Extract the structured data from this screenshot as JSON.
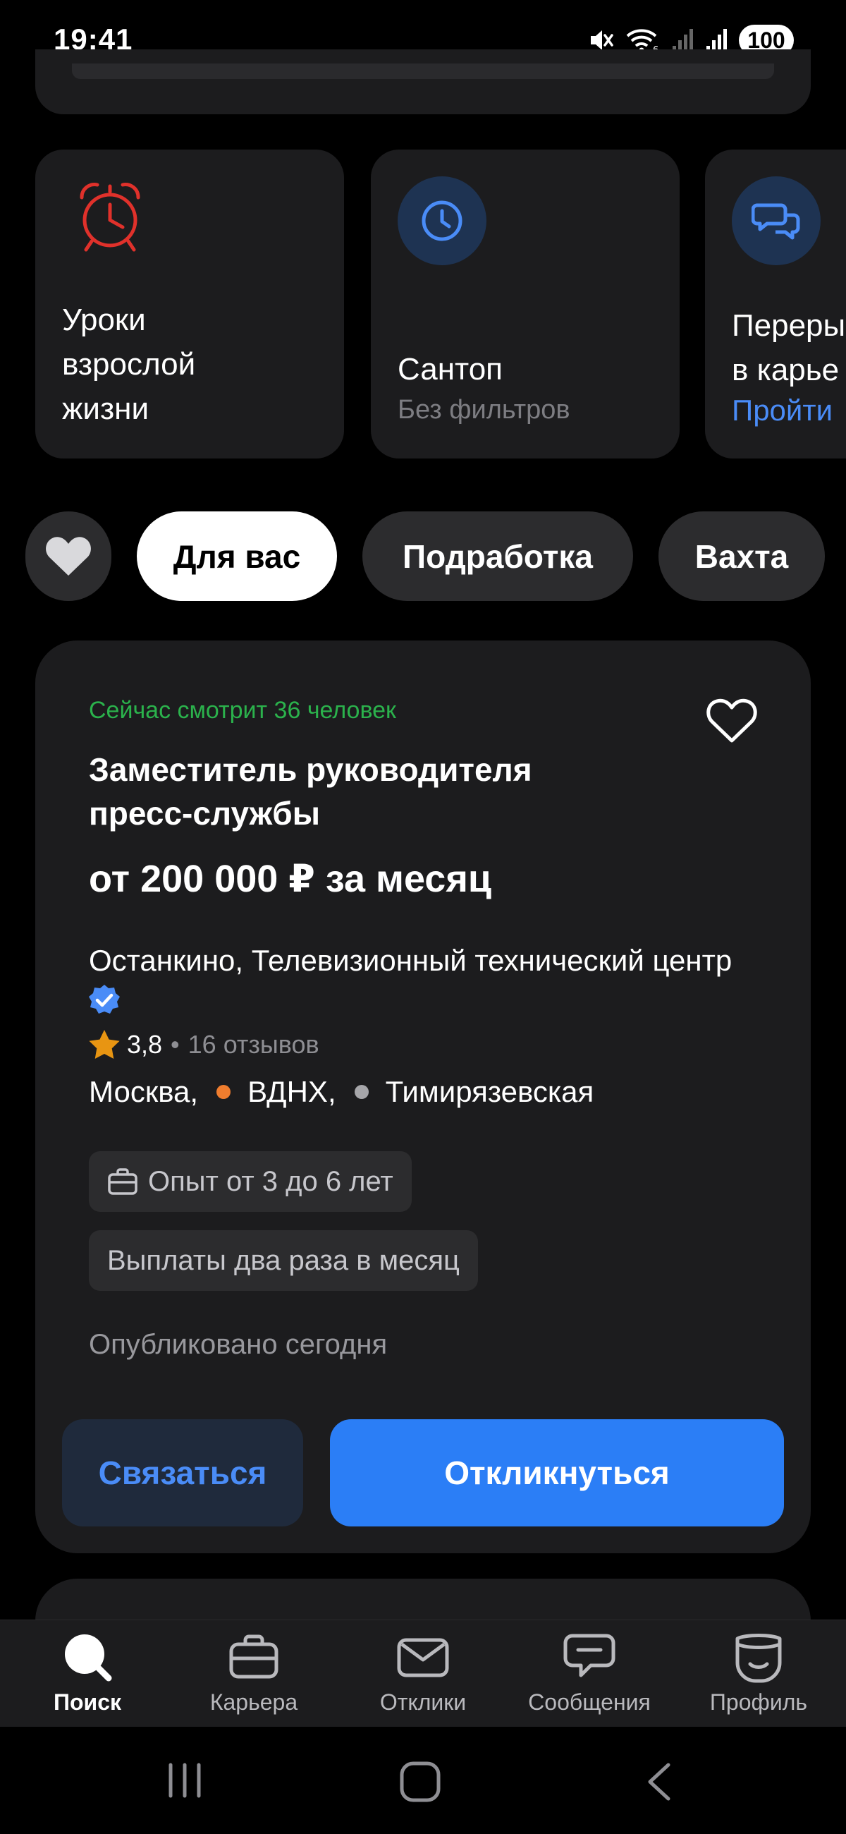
{
  "status_bar": {
    "time": "19:41",
    "battery": "100"
  },
  "stories": [
    {
      "title_lines": [
        "Уроки",
        "взрослой",
        "жизни"
      ],
      "icon": "alarm-clock-icon"
    },
    {
      "title": "Сантоп",
      "subtitle": "Без фильтров",
      "icon": "clock-icon"
    },
    {
      "title_lines": [
        "Переры",
        "в карье"
      ],
      "link": "Пройти",
      "icon": "chat-bubbles-icon"
    }
  ],
  "chips": {
    "favorites_icon": "heart-icon",
    "items": [
      "Для вас",
      "Подработка",
      "Вахта"
    ],
    "active": "Для вас"
  },
  "vacancy": {
    "viewers": "Сейчас смотрит 36 человек",
    "title_line1": "Заместитель руководителя",
    "title_line2": "пресс-службы",
    "salary": "от 200 000 ₽ за месяц",
    "company": "Останкино, Телевизионный технический центр",
    "rating": "3,8",
    "reviews": "16 отзывов",
    "city": "Москва,",
    "metro": [
      {
        "name": "ВДНХ,",
        "color": "#f07d2e"
      },
      {
        "name": "Тимирязевская",
        "color": "#a6a6aa"
      }
    ],
    "tags": [
      "Опыт от 3 до 6 лет",
      "Выплаты два раза в месяц"
    ],
    "published": "Опубликовано сегодня",
    "contact_button": "Связаться",
    "apply_button": "Откликнуться"
  },
  "tabbar": {
    "items": [
      {
        "label": "Поиск",
        "icon": "search-icon",
        "active": true
      },
      {
        "label": "Карьера",
        "icon": "briefcase-icon"
      },
      {
        "label": "Отклики",
        "icon": "envelope-icon"
      },
      {
        "label": "Сообщения",
        "icon": "chat-icon"
      },
      {
        "label": "Профиль",
        "icon": "profile-icon"
      }
    ]
  },
  "colors": {
    "accent": "#2b7ef6",
    "positive": "#2bb24c",
    "card": "#1c1c1e",
    "chip": "#2c2c2e"
  }
}
